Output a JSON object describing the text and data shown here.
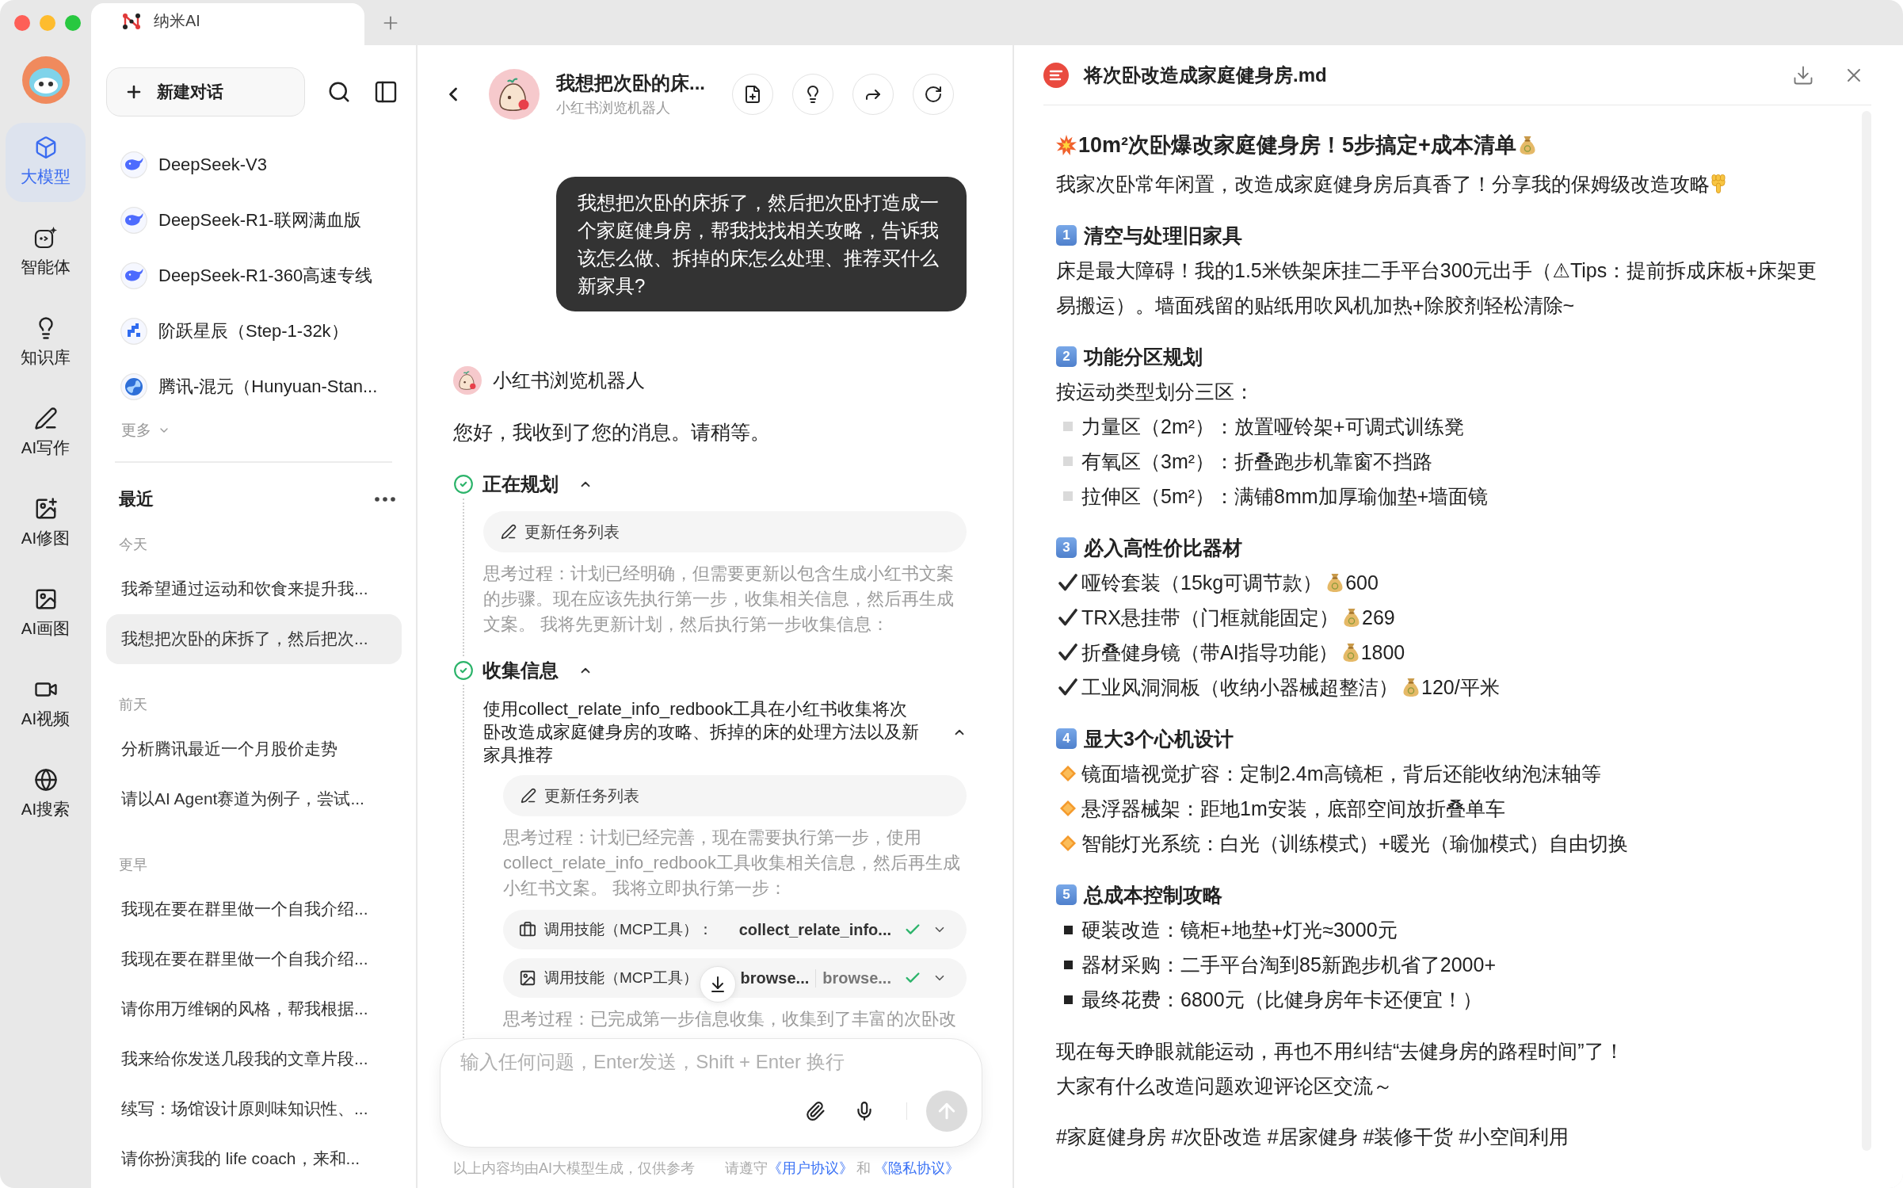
{
  "window": {
    "tab_title": "纳米AI"
  },
  "rail": {
    "items": [
      {
        "kind": "model",
        "label": "大模型",
        "selected": true
      },
      {
        "kind": "agent",
        "label": "智能体",
        "selected": false
      },
      {
        "kind": "knowledge",
        "label": "知识库",
        "selected": false
      },
      {
        "kind": "writing",
        "label": "AI写作",
        "selected": false
      },
      {
        "kind": "retouch",
        "label": "AI修图",
        "selected": false
      },
      {
        "kind": "painting",
        "label": "AI画图",
        "selected": false
      },
      {
        "kind": "video",
        "label": "AI视频",
        "selected": false
      },
      {
        "kind": "search",
        "label": "AI搜索",
        "selected": false
      }
    ]
  },
  "sidebar": {
    "new_chat": "新建对话",
    "models": [
      {
        "kind": "deepseek",
        "name": "DeepSeek-V3"
      },
      {
        "kind": "deepseek",
        "name": "DeepSeek-R1-联网满血版"
      },
      {
        "kind": "deepseek",
        "name": "DeepSeek-R1-360高速专线"
      },
      {
        "kind": "step",
        "name": "阶跃星辰（Step-1-32k）"
      },
      {
        "kind": "hunyuan",
        "name": "腾讯-混元（Hunyuan-Stan..."
      }
    ],
    "more": "更多",
    "recent_title": "最近",
    "groups": [
      {
        "label": "今天",
        "items": [
          {
            "title": "我希望通过运动和饮食来提升我...",
            "selected": false
          },
          {
            "title": "我想把次卧的床拆了，然后把次...",
            "selected": true
          }
        ]
      },
      {
        "label": "前天",
        "items": [
          {
            "title": "分析腾讯最近一个月股价走势",
            "selected": false
          },
          {
            "title": "请以AI Agent赛道为例子，尝试...",
            "selected": false
          }
        ]
      },
      {
        "label": "更早",
        "items": [
          {
            "title": "我现在要在群里做一个自我介绍...",
            "selected": false
          },
          {
            "title": "我现在要在群里做一个自我介绍...",
            "selected": false
          },
          {
            "title": "请你用万维钢的风格，帮我根据...",
            "selected": false
          },
          {
            "title": "我来给你发送几段我的文章片段...",
            "selected": false
          },
          {
            "title": "续写：场馆设计原则味知识性、...",
            "selected": false
          },
          {
            "title": "请你扮演我的 life coach，来和...",
            "selected": false
          }
        ]
      }
    ]
  },
  "chat": {
    "title": "我想把次卧的床...",
    "subtitle": "小红书浏览机器人",
    "user_message": "我想把次卧的床拆了，然后把次卧打造成一个家庭健身房，帮我找找相关攻略，告诉我该怎么做、拆掉的床怎么处理、推荐买什么新家具?",
    "bot_name": "小红书浏览机器人",
    "greeting": "您好，我收到了您的消息。请稍等。",
    "steps": [
      {
        "title": "正在规划",
        "done": true,
        "expanded": true,
        "entries": [
          {
            "kind": "tool",
            "label": "更新任务列表"
          },
          {
            "kind": "thought",
            "text": "思考过程：计划已经明确，但需要更新以包含生成小红书文案的步骤。现在应该先执行第一步，收集相关信息，然后再生成文案。 我将先更新计划，然后执行第一步收集信息："
          }
        ]
      },
      {
        "title": "收集信息",
        "done": true,
        "expanded": true,
        "entries": [
          {
            "kind": "task",
            "text": "使用collect_relate_info_redbook工具在小红书收集将次卧改造成家庭健身房的攻略、拆掉的床的处理方法以及新家具推荐",
            "expanded": true,
            "entries": [
              {
                "kind": "tool",
                "label": "更新任务列表"
              },
              {
                "kind": "thought",
                "text": "思考过程：计划已经完善，现在需要执行第一步，使用collect_relate_info_redbook工具收集相关信息，然后再生成小红书文案。 我将立即执行第一步："
              },
              {
                "kind": "collect-skill",
                "label": "调用技能（MCP工具）：",
                "names": [
                  "collect_relate_info..."
                ],
                "done": true,
                "expanded": false
              },
              {
                "kind": "browse-skill",
                "label": "调用技能（MCP工具）",
                "names": [
                  "browse...",
                  "browse..."
                ],
                "done": true,
                "expanded": false
              },
              {
                "kind": "thought",
                "text": "思考过程：已完成第一步信息收集，收集到了丰富的次卧改"
              }
            ]
          }
        ]
      }
    ],
    "input": {
      "placeholder": "输入任何问题，Enter发送，Shift + Enter 换行"
    },
    "footer": {
      "note": "以上内容均由AI大模型生成，仅供参考",
      "agree": "请遵守",
      "user_agreement": "《用户协议》",
      "and": "和",
      "privacy_policy": "《隐私协议》"
    }
  },
  "document": {
    "filename": "将次卧改造成家庭健身房.md",
    "title": "10m²次卧爆改家庭健身房！5步搞定+成本清单",
    "intro": "我家次卧常年闲置，改造成家庭健身房后真香了！分享我的保姆级改造攻略",
    "sections": [
      {
        "number": "1",
        "heading": "清空与处理旧家具",
        "blocks": [
          {
            "kind": "paragraph",
            "text": "床是最大障碍！我的1.5米铁架床挂二手平台300元出手（⚠Tips：提前拆成床板+床架更易搬运）。墙面残留的贴纸用吹风机加热+除胶剂轻松清除~"
          }
        ]
      },
      {
        "number": "2",
        "heading": "功能分区规划",
        "blocks": [
          {
            "kind": "paragraph",
            "text": "按运动类型划分三区："
          },
          {
            "kind": "square-light",
            "text": "力量区（2m²）：放置哑铃架+可调式训练凳"
          },
          {
            "kind": "square-light",
            "text": "有氧区（3m²）：折叠跑步机靠窗不挡路"
          },
          {
            "kind": "square-light",
            "text": "拉伸区（5m²）：满铺8mm加厚瑜伽垫+墙面镜"
          }
        ]
      },
      {
        "number": "3",
        "heading": "必入高性价比器材",
        "blocks": [
          {
            "kind": "check",
            "text": "哑铃套装（15kg可调节款）",
            "price": "600"
          },
          {
            "kind": "check",
            "text": "TRX悬挂带（门框就能固定）",
            "price": "269"
          },
          {
            "kind": "check",
            "text": "折叠健身镜（带AI指导功能）",
            "price": "1800"
          },
          {
            "kind": "check",
            "text": "工业风洞洞板（收纳小器械超整洁）",
            "price": "120/平米"
          }
        ]
      },
      {
        "number": "4",
        "heading": "显大3个心机设计",
        "blocks": [
          {
            "kind": "diamond",
            "text": "镜面墙视觉扩容：定制2.4m高镜柜，背后还能收纳泡沫轴等"
          },
          {
            "kind": "diamond",
            "text": "悬浮器械架：距地1m安装，底部空间放折叠单车"
          },
          {
            "kind": "diamond",
            "text": "智能灯光系统：白光（训练模式）+暖光（瑜伽模式）自由切换"
          }
        ]
      },
      {
        "number": "5",
        "heading": "总成本控制攻略",
        "blocks": [
          {
            "kind": "square-dark",
            "text": "硬装改造：镜柜+地垫+灯光≈3000元"
          },
          {
            "kind": "square-dark",
            "text": "器材采购：二手平台淘到85新跑步机省了2000+"
          },
          {
            "kind": "square-dark",
            "text": "最终花费：6800元（比健身房年卡还便宜！）"
          }
        ]
      }
    ],
    "closing": [
      "现在每天睁眼就能运动，再也不用纠结“去健身房的路程时间”了！",
      "大家有什么改造问题欢迎评论区交流～"
    ],
    "tags": "#家庭健身房 #次卧改造 #居家健身 #装修干货 #小空间利用"
  }
}
